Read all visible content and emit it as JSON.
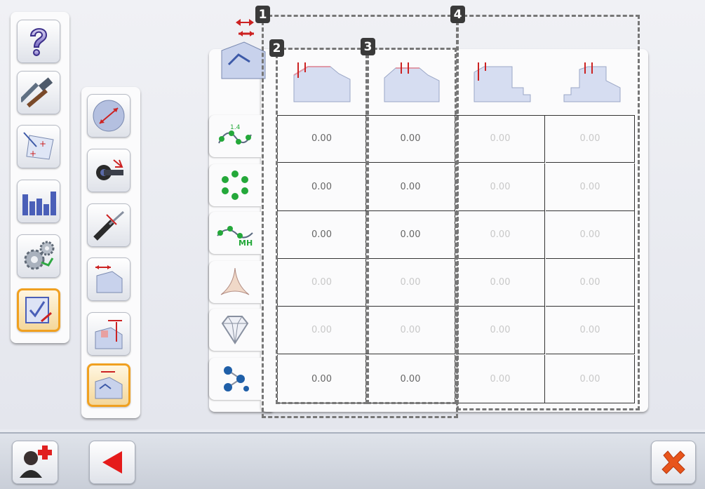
{
  "sidebar": {
    "items": [
      {
        "icon": "help-icon"
      },
      {
        "icon": "tools-hammer-icon"
      },
      {
        "icon": "calibration-icon"
      },
      {
        "icon": "statistics-chart-icon"
      },
      {
        "icon": "settings-gears-icon"
      },
      {
        "icon": "checklist-icon",
        "selected": true
      }
    ]
  },
  "submenu": {
    "items": [
      {
        "icon": "measure-distance-icon"
      },
      {
        "icon": "spindle-adjust-icon"
      },
      {
        "icon": "drill-depth-icon"
      },
      {
        "icon": "edge-offset-icon"
      },
      {
        "icon": "height-offset-icon"
      },
      {
        "icon": "profile-offset-icon",
        "selected": true
      }
    ]
  },
  "row_tabs": [
    {
      "icon": "curve-1-4-icon"
    },
    {
      "icon": "ring-cluster-icon"
    },
    {
      "icon": "curve-mh-icon"
    },
    {
      "icon": "star-tri-icon"
    },
    {
      "icon": "diamond-icon"
    },
    {
      "icon": "molecule-icon"
    }
  ],
  "columns": [
    {
      "icon": "profile-left-icon"
    },
    {
      "icon": "profile-center-icon"
    },
    {
      "icon": "profile-step-left-icon"
    },
    {
      "icon": "profile-step-right-icon"
    }
  ],
  "table": {
    "rows": [
      [
        "0.00",
        "0.00",
        "0.00",
        "0.00"
      ],
      [
        "0.00",
        "0.00",
        "0.00",
        "0.00"
      ],
      [
        "0.00",
        "0.00",
        "0.00",
        "0.00"
      ],
      [
        "0.00",
        "0.00",
        "0.00",
        "0.00"
      ],
      [
        "0.00",
        "0.00",
        "0.00",
        "0.00"
      ],
      [
        "0.00",
        "0.00",
        "0.00",
        "0.00"
      ]
    ],
    "enabled": [
      [
        true,
        true,
        false,
        false
      ],
      [
        true,
        true,
        false,
        false
      ],
      [
        true,
        true,
        false,
        false
      ],
      [
        false,
        false,
        false,
        false
      ],
      [
        false,
        false,
        false,
        false
      ],
      [
        true,
        true,
        false,
        false
      ]
    ]
  },
  "annotations": {
    "one": "1",
    "two": "2",
    "three": "3",
    "four": "4"
  },
  "bottom_bar": {
    "left_icons": [
      "add-user-icon",
      "back-arrow-icon"
    ],
    "right_icons": [
      "close-x-icon"
    ]
  },
  "colors": {
    "accent": "#f0a020",
    "disabled_text": "#c8c8c8",
    "value_text": "#666666",
    "marker_red": "#cc2222"
  }
}
